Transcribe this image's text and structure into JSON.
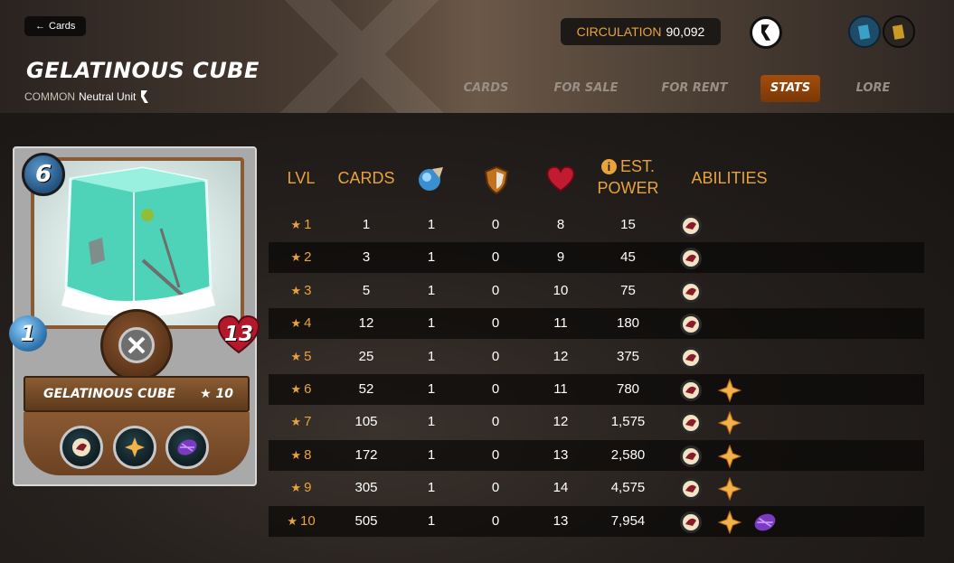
{
  "header": {
    "back_label": "Cards",
    "title": "GELATINOUS CUBE",
    "rarity": "COMMON",
    "type": "Neutral Unit",
    "circulation_label": "CIRCULATION",
    "circulation_value": "90,092"
  },
  "tabs": [
    {
      "label": "CARDS",
      "active": false
    },
    {
      "label": "FOR SALE",
      "active": false
    },
    {
      "label": "FOR RENT",
      "active": false
    },
    {
      "label": "STATS",
      "active": true
    },
    {
      "label": "LORE",
      "active": false
    }
  ],
  "card": {
    "mana": "6",
    "attack": "1",
    "health": "13",
    "name": "GELATINOUS CUBE",
    "level": "★ 10"
  },
  "table": {
    "headers": {
      "lvl": "LVL",
      "cards": "CARDS",
      "est_line1": "EST.",
      "est_line2": "POWER",
      "abilities": "ABILITIES"
    },
    "rows": [
      {
        "lvl": "1",
        "cards": "1",
        "attack": "1",
        "armor": "0",
        "health": "8",
        "power": "15",
        "abilities": [
          "scavenger"
        ]
      },
      {
        "lvl": "2",
        "cards": "3",
        "attack": "1",
        "armor": "0",
        "health": "9",
        "power": "45",
        "abilities": [
          "scavenger"
        ]
      },
      {
        "lvl": "3",
        "cards": "5",
        "attack": "1",
        "armor": "0",
        "health": "10",
        "power": "75",
        "abilities": [
          "scavenger"
        ]
      },
      {
        "lvl": "4",
        "cards": "12",
        "attack": "1",
        "armor": "0",
        "health": "11",
        "power": "180",
        "abilities": [
          "scavenger"
        ]
      },
      {
        "lvl": "5",
        "cards": "25",
        "attack": "1",
        "armor": "0",
        "health": "12",
        "power": "375",
        "abilities": [
          "scavenger"
        ]
      },
      {
        "lvl": "6",
        "cards": "52",
        "attack": "1",
        "armor": "0",
        "health": "11",
        "power": "780",
        "abilities": [
          "scavenger",
          "shatter"
        ]
      },
      {
        "lvl": "7",
        "cards": "105",
        "attack": "1",
        "armor": "0",
        "health": "12",
        "power": "1,575",
        "abilities": [
          "scavenger",
          "shatter"
        ]
      },
      {
        "lvl": "8",
        "cards": "172",
        "attack": "1",
        "armor": "0",
        "health": "13",
        "power": "2,580",
        "abilities": [
          "scavenger",
          "shatter"
        ]
      },
      {
        "lvl": "9",
        "cards": "305",
        "attack": "1",
        "armor": "0",
        "health": "14",
        "power": "4,575",
        "abilities": [
          "scavenger",
          "shatter"
        ]
      },
      {
        "lvl": "10",
        "cards": "505",
        "attack": "1",
        "armor": "0",
        "health": "13",
        "power": "7,954",
        "abilities": [
          "scavenger",
          "shatter",
          "camouflage"
        ]
      }
    ]
  },
  "colors": {
    "accent": "#e8a33d",
    "active_tab": "#a34d0c"
  }
}
